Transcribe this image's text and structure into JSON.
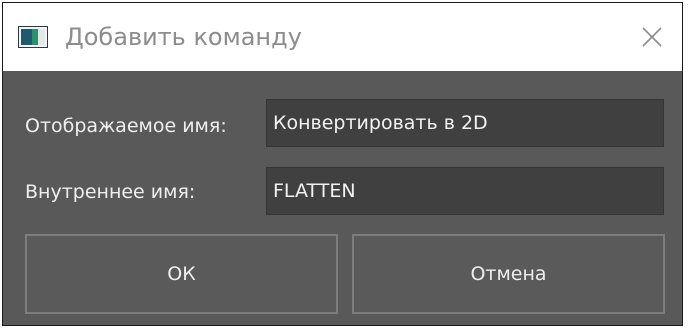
{
  "window": {
    "title": "Добавить команду",
    "app_icon": "app-window-icon",
    "close_icon": "close-icon"
  },
  "form": {
    "display_name_label": "Отображаемое имя:",
    "display_name_value": "Конвертировать в 2D",
    "internal_name_label": "Внутреннее имя:",
    "internal_name_value": "FLATTEN"
  },
  "buttons": {
    "ok_label": "ОК",
    "cancel_label": "Отмена"
  },
  "colors": {
    "dialog_background": "#595959",
    "titlebar_background": "#ffffff",
    "field_background": "#404040",
    "button_border": "#7d7d7d",
    "text": "#eeeeee",
    "title_text": "#8c8c8c"
  }
}
